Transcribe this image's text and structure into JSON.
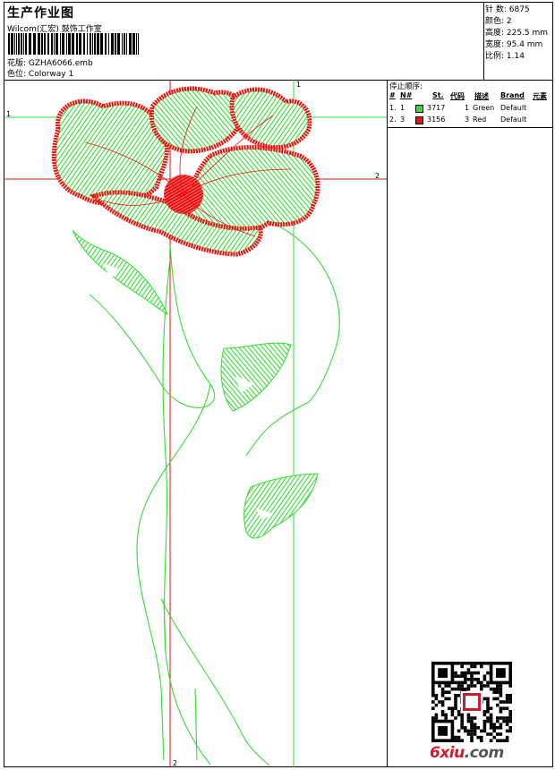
{
  "header": {
    "title": "生产作业图",
    "company": "Wilcom(汇宏) 鼓饰工作室",
    "design_label": "花版:",
    "design_value": "GZHA6066.emb",
    "color_label": "色位:",
    "color_value": "Colorway 1"
  },
  "stats": {
    "stitches": "针 数: 6875",
    "colors": "颜色: 2",
    "height": "高度: 225.5 mm",
    "width": "宽度: 95.4 mm",
    "scale": "比例: 1.14"
  },
  "stop_sequence": {
    "caption": "停止顺序:",
    "headers": {
      "idx": "#",
      "needle": "N#",
      "stitches": "St.",
      "code": "代码",
      "desc": "描述",
      "brand": "Brand",
      "element": "元素"
    },
    "rows": [
      {
        "idx": "1.",
        "needle": "1",
        "color": "#33dd33",
        "stitches": "3717",
        "code": "1",
        "desc": "Green",
        "brand": "Default"
      },
      {
        "idx": "2.",
        "needle": "3",
        "color": "#ee1111",
        "stitches": "3156",
        "code": "3",
        "desc": "Red",
        "brand": "Default"
      }
    ]
  },
  "markers": {
    "m1": "1",
    "m2": "2"
  },
  "watermark": {
    "brand": "6xiu",
    "tld": ".com"
  },
  "colors": {
    "green": "#33dd33",
    "red": "#ee1111"
  }
}
